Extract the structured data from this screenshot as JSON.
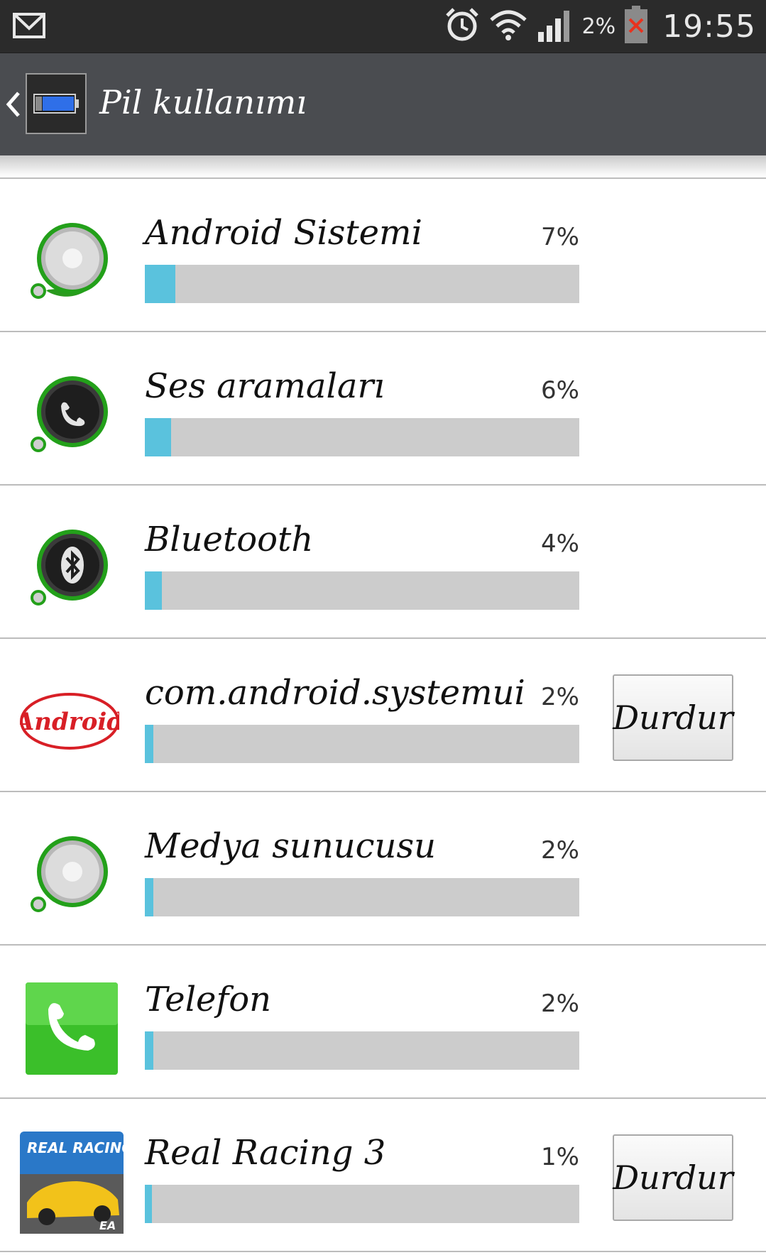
{
  "status_bar": {
    "battery_percent": "2%",
    "time": "19:55",
    "icons": [
      "gmail-icon",
      "alarm-icon",
      "wifi-icon",
      "signal-icon",
      "battery-icon"
    ]
  },
  "action_bar": {
    "title": "Pil kullanımı",
    "icon": "battery-icon"
  },
  "items": [
    {
      "name": "Android Sistemi",
      "percent": "7%",
      "value": 7,
      "icon": "android-system-icon",
      "stop_label": ""
    },
    {
      "name": "Ses aramaları",
      "percent": "6%",
      "value": 6,
      "icon": "voice-call-icon",
      "stop_label": ""
    },
    {
      "name": "Bluetooth",
      "percent": "4%",
      "value": 4,
      "icon": "bluetooth-icon",
      "stop_label": ""
    },
    {
      "name": "com.android.systemui",
      "percent": "2%",
      "value": 2,
      "icon": "android-logo-icon",
      "stop_label": "Durdur"
    },
    {
      "name": "Medya sunucusu",
      "percent": "2%",
      "value": 2,
      "icon": "media-server-icon",
      "stop_label": ""
    },
    {
      "name": "Telefon",
      "percent": "2%",
      "value": 2,
      "icon": "phone-app-icon",
      "stop_label": ""
    },
    {
      "name": "Real Racing 3",
      "percent": "1%",
      "value": 1,
      "icon": "real-racing-icon",
      "stop_label": "Durdur"
    }
  ],
  "colors": {
    "bar_fill": "#5ac2dd",
    "bar_track": "#cccccc",
    "action_bar": "#4a4c50",
    "status_bar": "#2b2b2b"
  },
  "logo_text": {
    "android": "Android",
    "real_racing": "REAL RACING",
    "ea": "EA"
  }
}
